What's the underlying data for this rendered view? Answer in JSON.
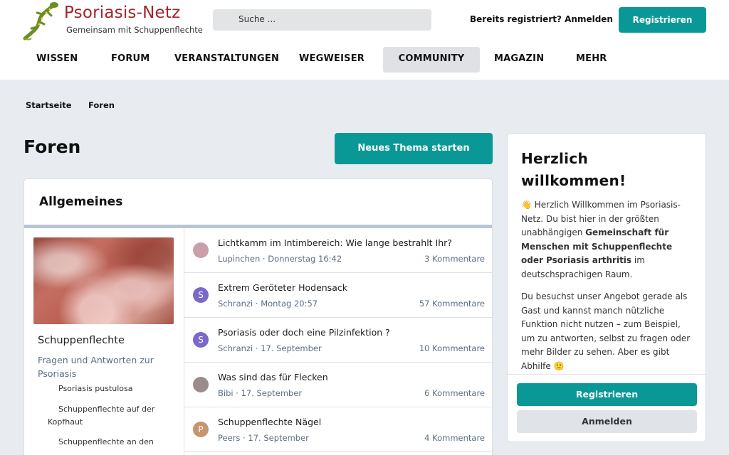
{
  "header": {
    "logo_title": "Psoriasis-Netz",
    "logo_subtitle": "Gemeinsam mit Schuppenflechte",
    "search_placeholder": "Suche ...",
    "login_link": "Bereits registriert? Anmelden",
    "register_button": "Registrieren"
  },
  "nav": {
    "items": [
      {
        "label": "WISSEN"
      },
      {
        "label": "FORUM"
      },
      {
        "label": "VERANSTALTUNGEN"
      },
      {
        "label": "WEGWEISER"
      },
      {
        "label": "COMMUNITY"
      },
      {
        "label": "MAGAZIN"
      },
      {
        "label": "MEHR"
      }
    ]
  },
  "breadcrumb": [
    "Startseite",
    "Foren"
  ],
  "page": {
    "title": "Foren",
    "new_topic_button": "Neues Thema starten"
  },
  "section": {
    "title": "Allgemeines",
    "forum": {
      "name": "Schuppenflechte",
      "description": "Fragen und Antworten zur Psoriasis",
      "subforums": [
        "Psoriasis pustulosa",
        "Schuppenflechte auf der Kopfhaut",
        "Schuppenflechte an den"
      ]
    },
    "threads": [
      {
        "title": "Lichtkamm im Intimbereich: Wie lange bestrahlt Ihr?",
        "author": "Lupinchen",
        "date": "Donnerstag 16:42",
        "comments": "3 Kommentare",
        "avatar": "",
        "avatar_color": "#c9a0a8"
      },
      {
        "title": "Extrem Geröteter Hodensack",
        "author": "Schranzi",
        "date": "Montag 20:57",
        "comments": "57 Kommentare",
        "avatar": "S",
        "avatar_color": "#7b68c8"
      },
      {
        "title": "Psoriasis oder doch eine Pilzinfektion ?",
        "author": "Schranzi",
        "date": "17. September",
        "comments": "10 Kommentare",
        "avatar": "S",
        "avatar_color": "#7b68c8"
      },
      {
        "title": "Was sind das für Flecken",
        "author": "Bibi",
        "date": "17. September",
        "comments": "6 Kommentare",
        "avatar": "",
        "avatar_color": "#9a8c8c"
      },
      {
        "title": "Schuppenflechte Nägel",
        "author": "Peers",
        "date": "17. September",
        "comments": "4 Kommentare",
        "avatar": "P",
        "avatar_color": "#c8956a"
      }
    ]
  },
  "welcome": {
    "title": "Herzlich willkommen!",
    "p1_prefix": "👋 Herzlich Willkommen im Psoriasis-Netz. Du bist hier in der größten unabhängigen ",
    "p1_bold": "Gemeinschaft für Menschen mit Schuppenflechte oder Psoriasis arthritis",
    "p1_suffix": " im deutschsprachigen Raum.",
    "p2": "Du besuchst unser Angebot gerade als Gast und kannst manch nützliche Funktion nicht nutzen – zum Beispiel, um zu antworten, selbst zu fragen oder mehr Bilder zu sehen. Aber es gibt Abhilfe 🙂",
    "register_button": "Registrieren",
    "login_button": "Anmelden"
  },
  "colors": {
    "accent": "#0a9896",
    "logo_red": "#a4232b",
    "muted_text": "#5c6e84"
  }
}
